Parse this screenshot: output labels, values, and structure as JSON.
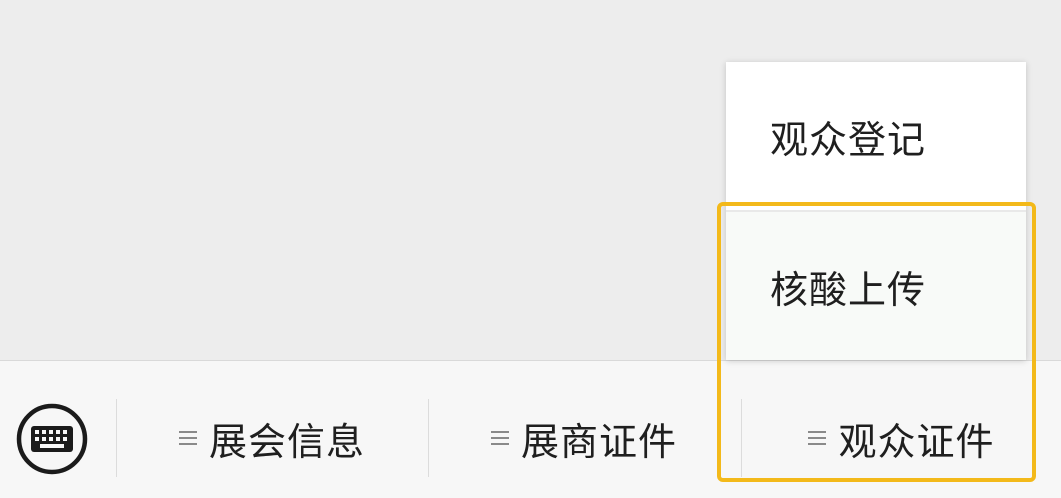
{
  "colors": {
    "background": "#ededed",
    "bottom_bar": "#f7f7f7",
    "popup": "#ffffff",
    "highlight": "#f3b91a",
    "text": "#1f1f1f"
  },
  "bottom_bar": {
    "keyboard_icon": "keyboard-icon",
    "menu_icon": "menu-lines-icon",
    "tabs": [
      {
        "label": "展会信息"
      },
      {
        "label": "展商证件"
      },
      {
        "label": "观众证件"
      }
    ]
  },
  "popup_menu": {
    "items": [
      {
        "label": "观众登记"
      },
      {
        "label": "核酸上传"
      }
    ]
  }
}
